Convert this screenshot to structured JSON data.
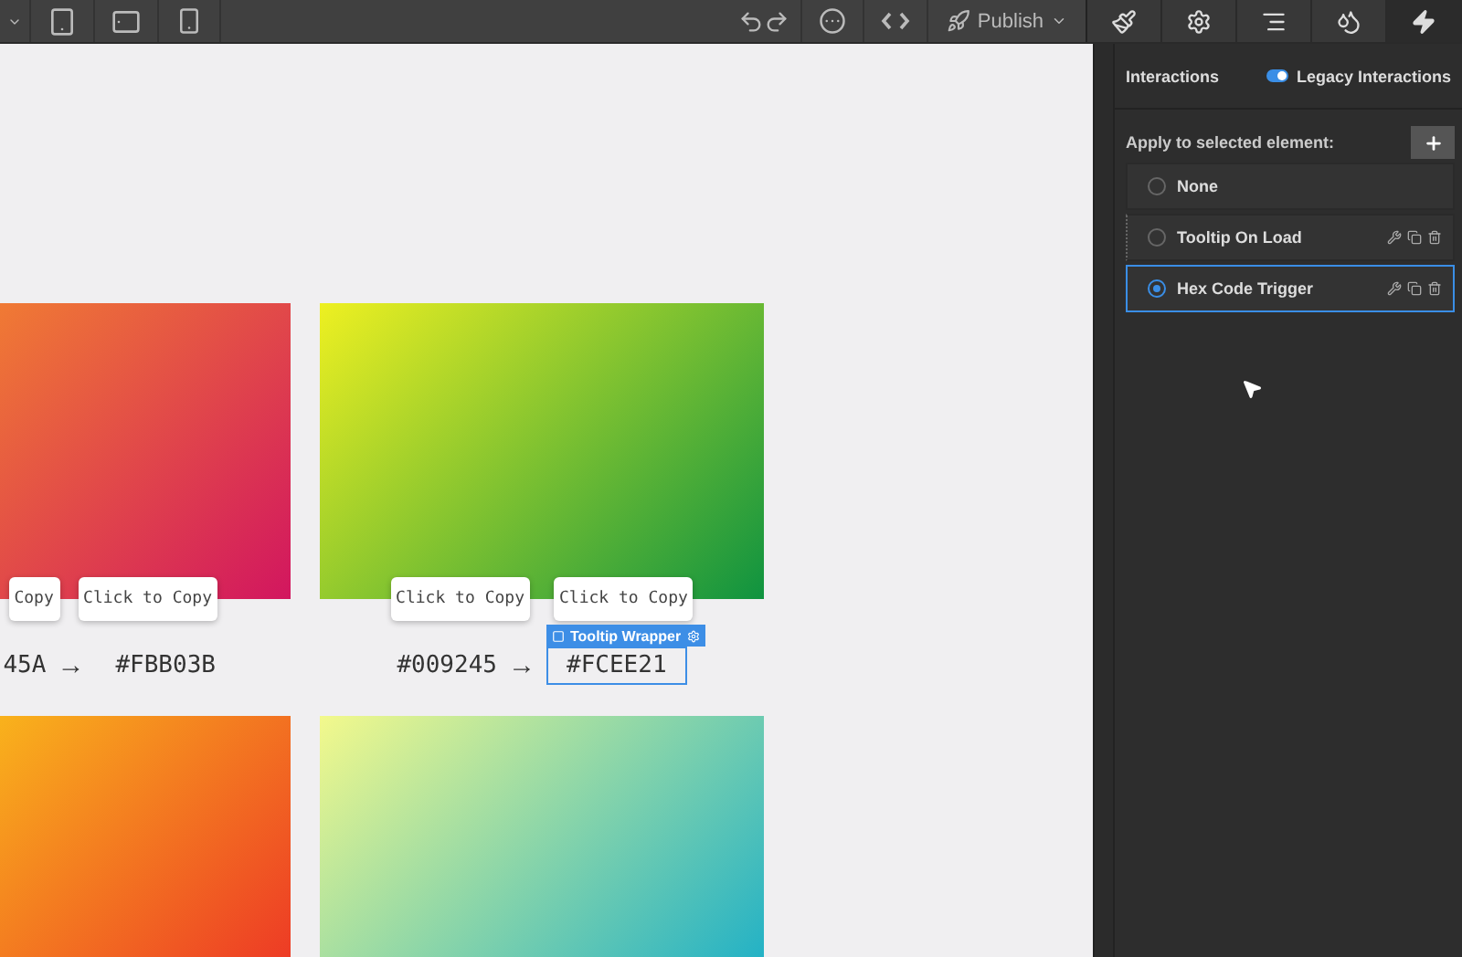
{
  "toolbar": {
    "devices": [
      {
        "kind": "tablet",
        "selected": false
      },
      {
        "kind": "landscape",
        "selected": false
      },
      {
        "kind": "phone",
        "selected": false
      }
    ],
    "publish": "Publish"
  },
  "panel_tabs": [
    {
      "kind": "style",
      "selected": false
    },
    {
      "kind": "settings",
      "selected": false
    },
    {
      "kind": "navigator",
      "selected": false
    },
    {
      "kind": "drops",
      "selected": false
    },
    {
      "kind": "interactions",
      "selected": true
    }
  ],
  "cards": [
    {
      "kind": "swatch",
      "buttons": [
        "Copy",
        "Click to Copy"
      ],
      "hex_from": "45A",
      "arrow": "→",
      "hex_to": "#FBB03B"
    },
    {
      "kind": "swatch",
      "buttons": [
        "Click to Copy",
        "Click to Copy"
      ],
      "hex_from": "#009245",
      "arrow": "→",
      "hex_to": "#FCEE21",
      "selection_label": "Tooltip Wrapper"
    },
    {
      "kind": "swatch"
    },
    {
      "kind": "swatch"
    }
  ],
  "panel": {
    "title": "Interactions",
    "legacy": {
      "label": "Legacy Interactions",
      "on": true
    },
    "apply_label": "Apply to selected element:",
    "items": [
      {
        "label": "None",
        "selected": false,
        "editable": false
      },
      {
        "label": "Tooltip On Load",
        "selected": false,
        "editable": true
      },
      {
        "label": "Hex Code Trigger",
        "selected": true,
        "editable": true
      }
    ]
  }
}
